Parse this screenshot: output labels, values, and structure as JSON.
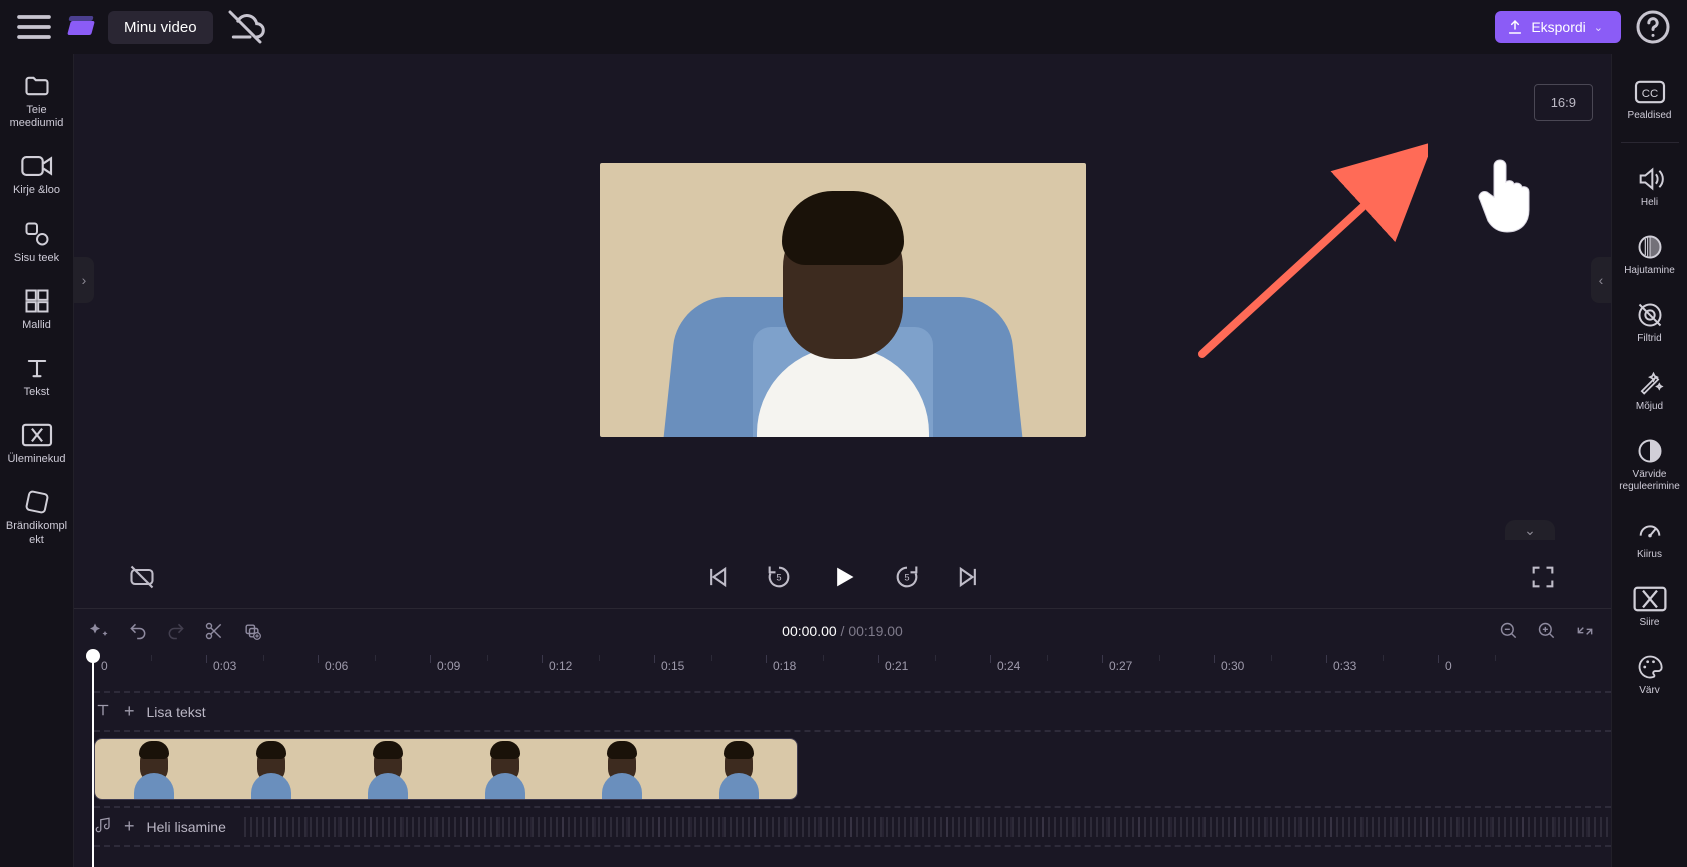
{
  "header": {
    "title": "Minu video",
    "export_label": "Ekspordi"
  },
  "left_rail": {
    "items": [
      {
        "label": "Teie meediumid"
      },
      {
        "label": "Kirje &amp;loo"
      },
      {
        "label": "Sisu teek"
      },
      {
        "label": "Mallid"
      },
      {
        "label": "Tekst"
      },
      {
        "label": "Üleminekud"
      },
      {
        "label": "Brändikomplekt"
      }
    ]
  },
  "stage": {
    "aspect_ratio": "16:9"
  },
  "playback": {
    "current_time": "00:00.00",
    "duration_time": "00:19.00"
  },
  "ruler": {
    "ticks": [
      "0",
      "0:03",
      "0:06",
      "0:09",
      "0:12",
      "0:15",
      "0:18",
      "0:21",
      "0:24",
      "0:27",
      "0:30",
      "0:33",
      "0"
    ]
  },
  "tracks": {
    "text_track_label": "Lisa tekst",
    "audio_track_label": "Heli lisamine"
  },
  "right_rail": {
    "items": [
      {
        "label": "Pealdised"
      },
      {
        "label": "Heli"
      },
      {
        "label": "Hajutamine"
      },
      {
        "label": "Filtrid"
      },
      {
        "label": "Mõjud"
      },
      {
        "label": "Värvide reguleerimine"
      },
      {
        "label": "Kiirus"
      },
      {
        "label": "Siire"
      },
      {
        "label": "Värv"
      }
    ]
  }
}
